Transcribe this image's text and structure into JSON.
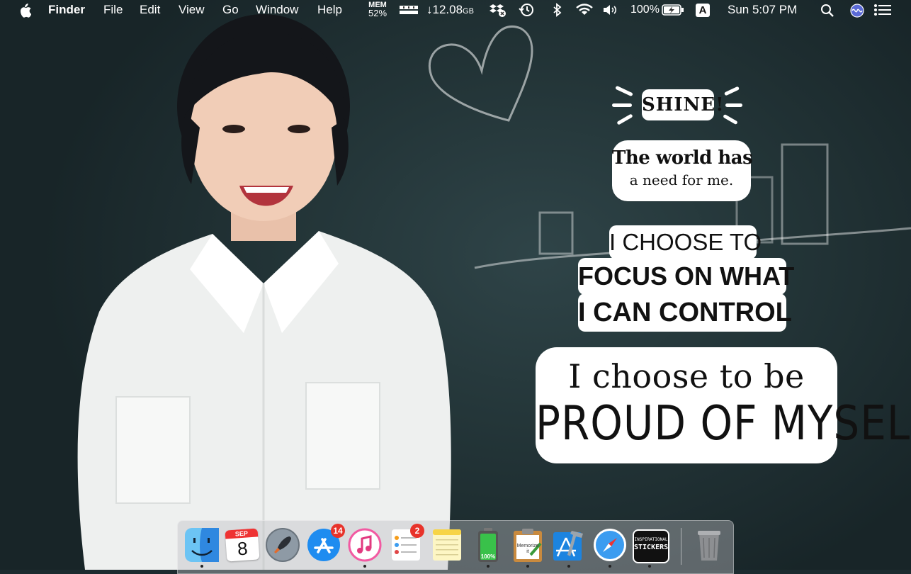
{
  "menubar": {
    "apple_icon": "apple-icon",
    "app_name": "Finder",
    "menus": [
      "File",
      "Edit",
      "View",
      "Go",
      "Window",
      "Help"
    ],
    "mem_label": "MEM",
    "mem_value": "52%",
    "download_value": "↓12.08",
    "download_unit": "GB",
    "battery_percent": "100%",
    "input_source": "A",
    "clock": "Sun 5:07 PM"
  },
  "stickers": {
    "shine": "SHINE!",
    "world_line1": "The world has",
    "world_line2": "a need for me.",
    "focus_line1": "I CHOOSE TO",
    "focus_line2": "FOCUS ON WHAT",
    "focus_line3": "I CAN CONTROL",
    "proud_line1": "I choose to be",
    "proud_line2": "PROUD OF MYSELF."
  },
  "dock": {
    "calendar_month": "SEP",
    "calendar_day": "8",
    "app_store_badge": "14",
    "reminders_badge": "2",
    "battery_app_label": "100%",
    "memorize_label": "Memorize it",
    "stickers_label_1": "INSPIRATIONAL",
    "stickers_label_2": "STICKERS"
  }
}
